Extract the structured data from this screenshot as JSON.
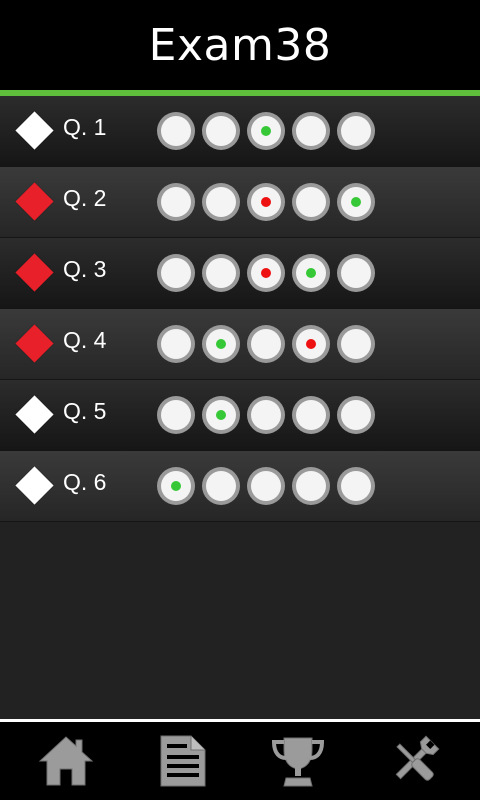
{
  "header": {
    "title": "Exam38"
  },
  "colors": {
    "accent_line": "#5fbe3b",
    "correct_dot": "#37c837",
    "wrong_dot": "#ee1111",
    "diamond_unanswered": "#ffffff",
    "diamond_wrong": "#e8202a"
  },
  "questions": [
    {
      "label": "Q. 1",
      "status": "neutral",
      "options": [
        "",
        "",
        "correct",
        "",
        ""
      ]
    },
    {
      "label": "Q. 2",
      "status": "wrong",
      "options": [
        "",
        "",
        "wrong",
        "",
        "correct"
      ]
    },
    {
      "label": "Q. 3",
      "status": "wrong",
      "options": [
        "",
        "",
        "wrong",
        "correct",
        ""
      ]
    },
    {
      "label": "Q. 4",
      "status": "wrong",
      "options": [
        "",
        "correct",
        "",
        "wrong",
        ""
      ]
    },
    {
      "label": "Q. 5",
      "status": "neutral",
      "options": [
        "",
        "correct",
        "",
        "",
        ""
      ]
    },
    {
      "label": "Q. 6",
      "status": "neutral",
      "options": [
        "correct",
        "",
        "",
        "",
        ""
      ]
    }
  ],
  "bottom_nav": [
    {
      "name": "home",
      "icon": "home-icon"
    },
    {
      "name": "document",
      "icon": "document-icon"
    },
    {
      "name": "trophy",
      "icon": "trophy-icon"
    },
    {
      "name": "settings",
      "icon": "tools-icon"
    }
  ]
}
